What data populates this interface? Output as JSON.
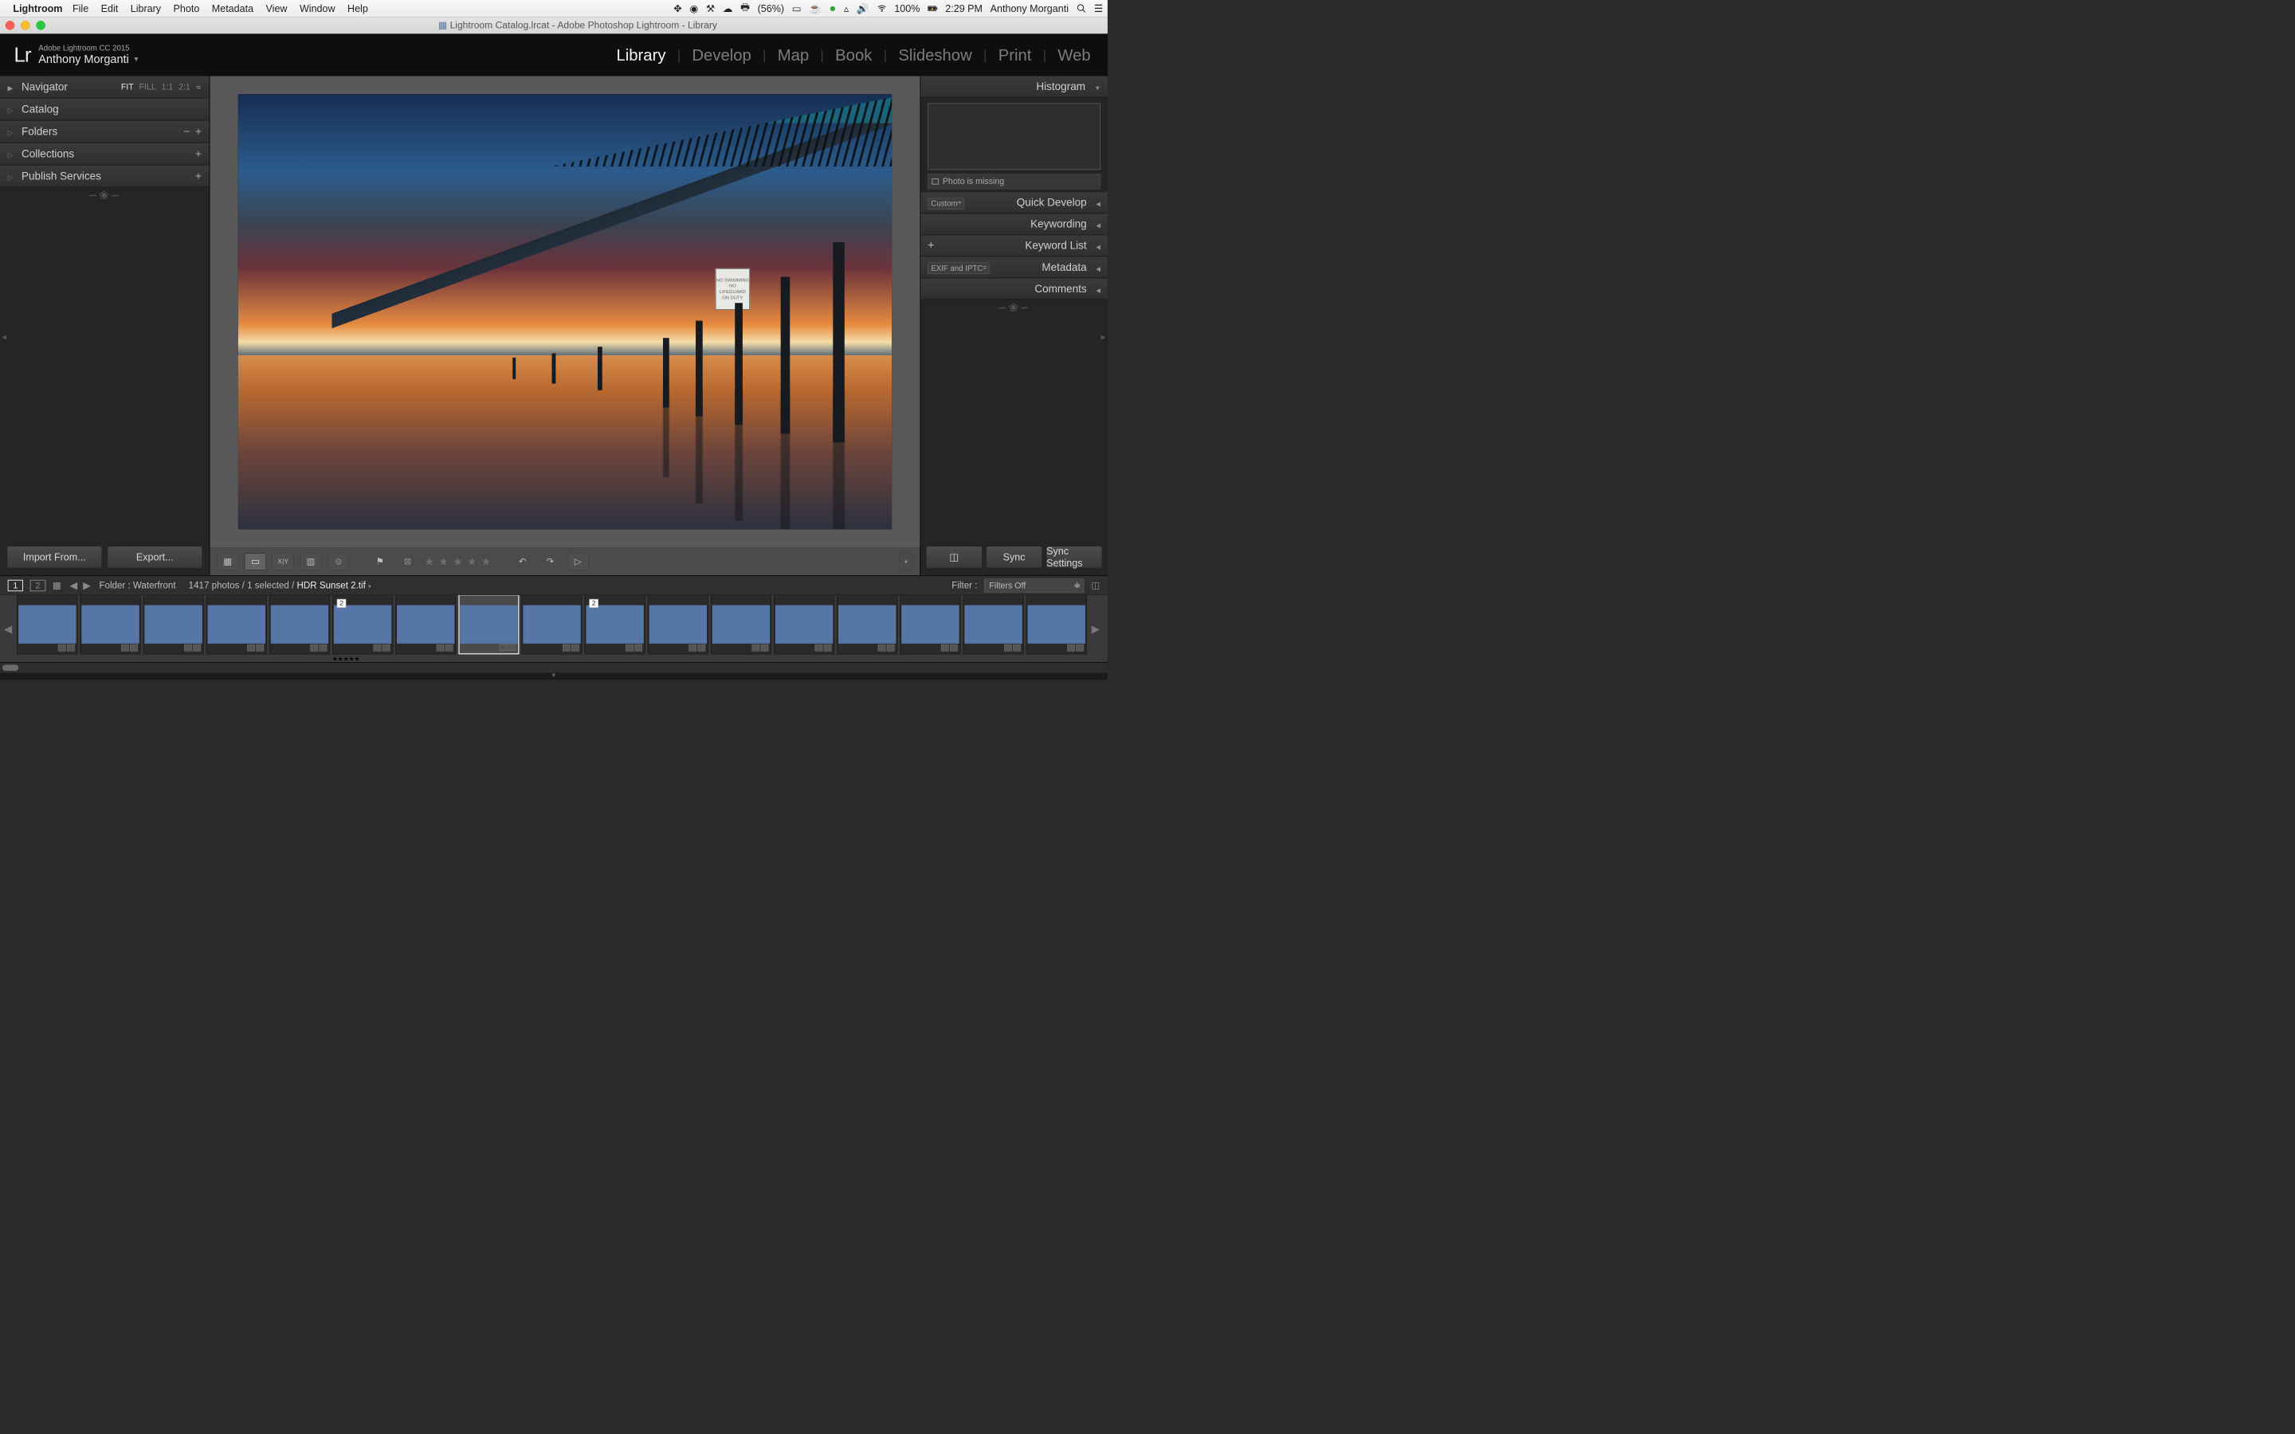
{
  "menubar": {
    "app": "Lightroom",
    "items": [
      "File",
      "Edit",
      "Library",
      "Photo",
      "Metadata",
      "View",
      "Window",
      "Help"
    ],
    "battery_text": "(56%)",
    "wifi_pct": "100%",
    "time": "2:29 PM",
    "user": "Anthony Morganti"
  },
  "titlebar": {
    "title": "Lightroom Catalog.lrcat - Adobe Photoshop Lightroom - Library"
  },
  "identity": {
    "logo": "Lr",
    "version": "Adobe Lightroom CC 2015",
    "user": "Anthony Morganti"
  },
  "modules": [
    "Library",
    "Develop",
    "Map",
    "Book",
    "Slideshow",
    "Print",
    "Web"
  ],
  "active_module": "Library",
  "left": {
    "navigator": "Navigator",
    "nav_modes": [
      "FIT",
      "FILL",
      "1:1",
      "2:1"
    ],
    "nav_active": "FIT",
    "panels": [
      {
        "label": "Catalog",
        "actions": []
      },
      {
        "label": "Folders",
        "actions": [
          "−",
          "+"
        ]
      },
      {
        "label": "Collections",
        "actions": [
          "+"
        ]
      },
      {
        "label": "Publish Services",
        "actions": [
          "+"
        ]
      }
    ],
    "import_btn": "Import From...",
    "export_btn": "Export..."
  },
  "right": {
    "histogram": "Histogram",
    "missing": "Photo is missing",
    "quick_develop": "Quick Develop",
    "qd_preset": "Custom",
    "keywording": "Keywording",
    "keyword_list": "Keyword List",
    "metadata": "Metadata",
    "metadata_preset": "EXIF and IPTC",
    "comments": "Comments",
    "sync": "Sync",
    "sync_settings": "Sync Settings"
  },
  "sign_lines": [
    "NO SWIMMING",
    "NO LIFEGUARD",
    "ON DUTY"
  ],
  "filmstrip_header": {
    "src1": "1",
    "src2": "2",
    "folder_label": "Folder :",
    "folder_name": "Waterfront",
    "count_text": "1417 photos / 1 selected /",
    "selected_name": "HDR Sunset 2.tif",
    "filter_label": "Filter :",
    "filter_value": "Filters Off"
  },
  "thumbs": [
    {
      "variant": "t-sky"
    },
    {
      "variant": "t-boats"
    },
    {
      "variant": "t-grain"
    },
    {
      "variant": "t-sky"
    },
    {
      "variant": "t-red"
    },
    {
      "variant": "t-bw1",
      "stack": "2",
      "stars": true
    },
    {
      "variant": "t-bw2"
    },
    {
      "variant": "t-sunset",
      "selected": true
    },
    {
      "variant": "t-cyan"
    },
    {
      "variant": "t-bwpier",
      "stack": "2"
    },
    {
      "variant": "t-bwpier"
    },
    {
      "variant": "t-over1"
    },
    {
      "variant": "t-over2"
    },
    {
      "variant": "t-over3"
    },
    {
      "variant": "t-over4"
    },
    {
      "variant": "t-sepia"
    },
    {
      "variant": "t-struct"
    }
  ]
}
